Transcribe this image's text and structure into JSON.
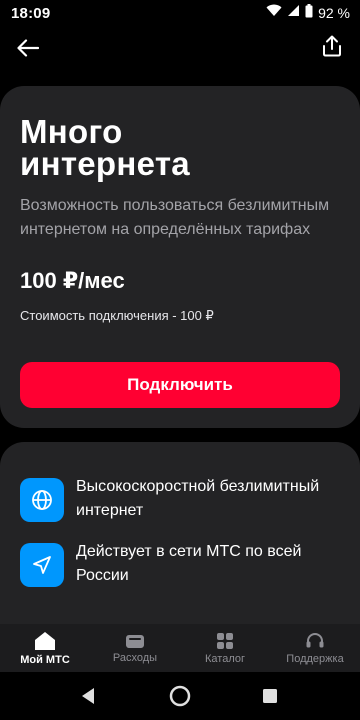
{
  "status_bar": {
    "time": "18:09",
    "battery": "92 %",
    "icons": [
      "wifi-icon",
      "signal-icon",
      "battery-icon"
    ]
  },
  "appbar": {
    "back_icon": "arrow-left-icon",
    "share_icon": "share-icon"
  },
  "offer": {
    "title_line1": "Много",
    "title_line2": "интернета",
    "description": "Возможность пользоваться безлимитным интернетом на определённых тарифах",
    "price": "100 ₽/мес",
    "connection_cost": "Стоимость подключения - 100 ₽",
    "connect_button": "Подключить"
  },
  "features": [
    {
      "icon": "globe-icon",
      "text": "Высокоскоростной безлимитный интернет"
    },
    {
      "icon": "send-icon",
      "text": "Действует в сети МТС по всей России"
    }
  ],
  "bottom_nav": [
    {
      "icon": "home-icon",
      "label": "Мой МТС",
      "active": true
    },
    {
      "icon": "wallet-icon",
      "label": "Расходы",
      "active": false
    },
    {
      "icon": "grid-icon",
      "label": "Каталог",
      "active": false
    },
    {
      "icon": "headset-icon",
      "label": "Поддержка",
      "active": false
    }
  ],
  "colors": {
    "accent": "#ff0032",
    "feature_icon_bg": "#0097fd",
    "card_bg": "#232325",
    "background": "#000000"
  }
}
